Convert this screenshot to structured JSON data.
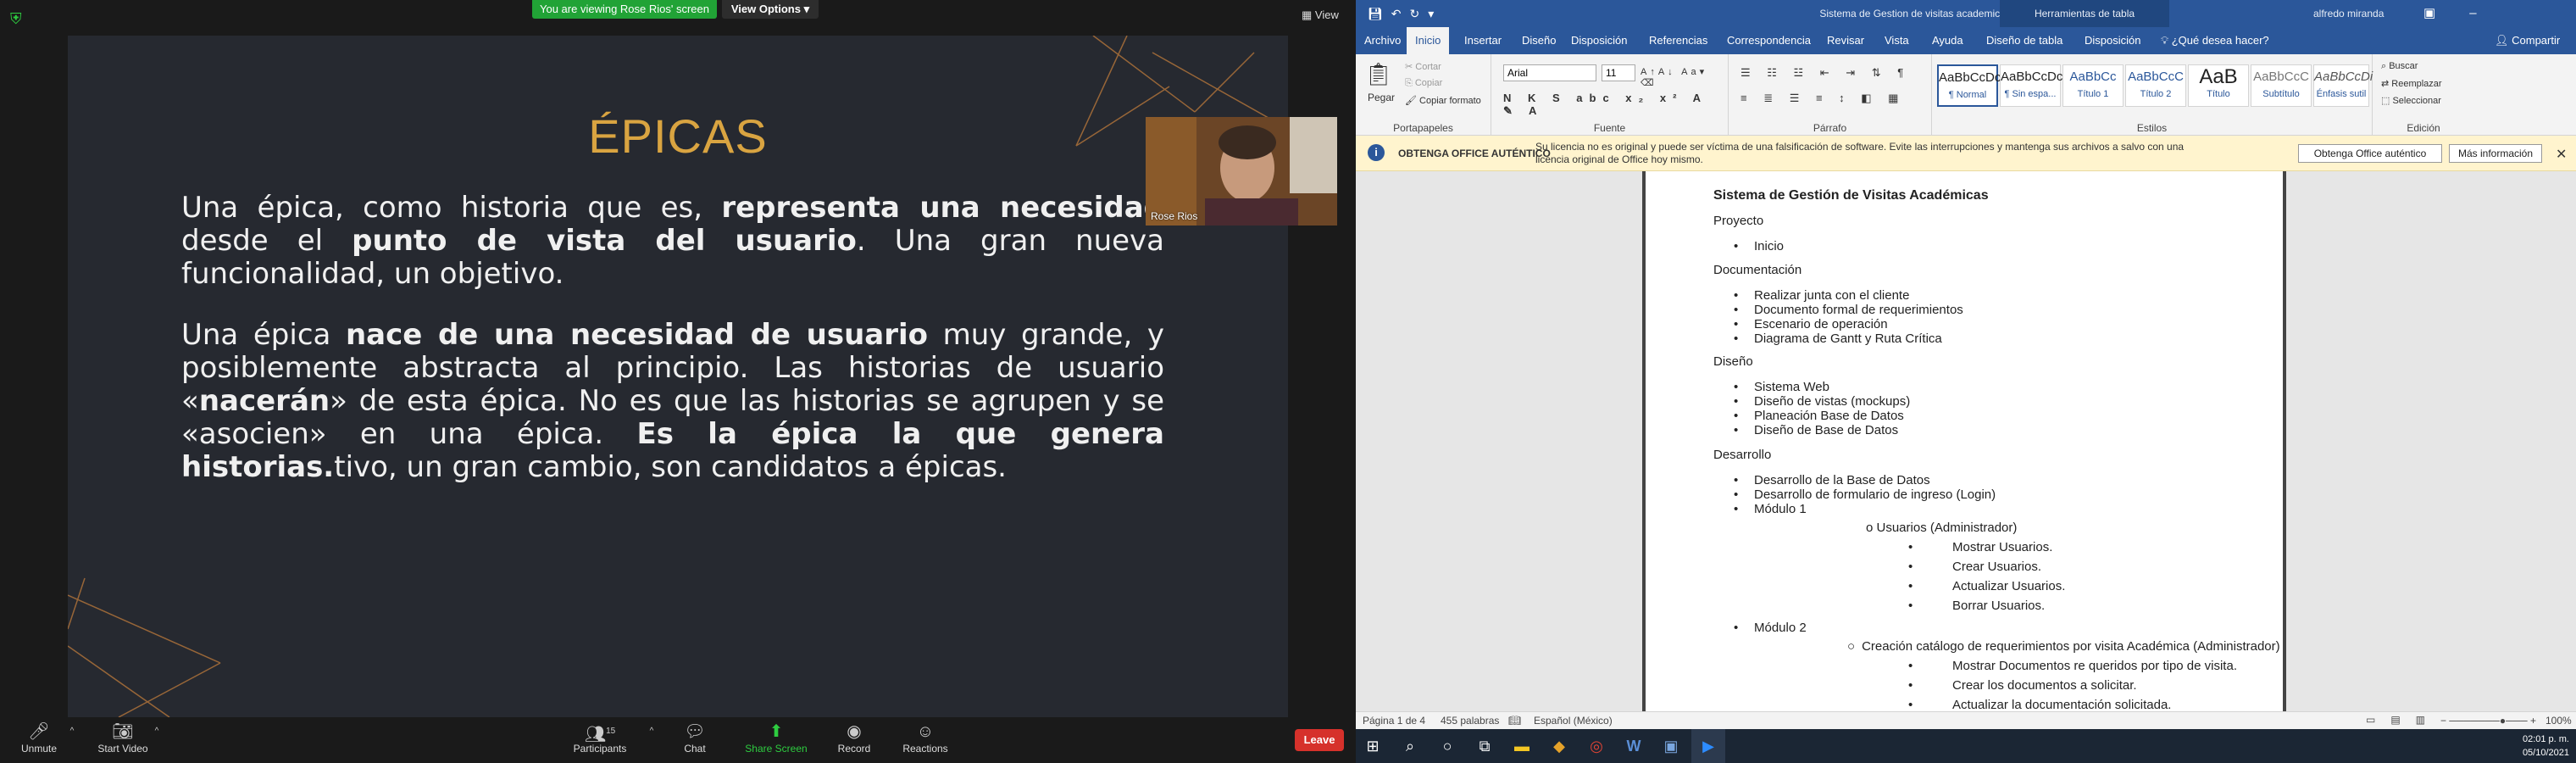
{
  "zoom": {
    "viewing_banner": "You are viewing Rose Rios' screen",
    "view_options": "View Options ▾",
    "view_btn": "View",
    "participant_name": "Rose Rios",
    "slide": {
      "title": "ÉPICAS",
      "para1": [
        {
          "t": "Una épica, como historia que es, ",
          "b": false
        },
        {
          "t": "representa una necesidad",
          "b": true
        },
        {
          "t": " desde el ",
          "b": false
        },
        {
          "t": "punto de vista del usuario",
          "b": true
        },
        {
          "t": ". Una gran nueva funcionalidad, un objetivo.",
          "b": false
        }
      ],
      "para2": [
        {
          "t": "Una épica ",
          "b": false
        },
        {
          "t": "nace de una necesidad de usuario",
          "b": true
        },
        {
          "t": " muy grande, y posiblemente abstracta al principio. Las historias de usuario «",
          "b": false
        },
        {
          "t": "nacerán",
          "b": true
        },
        {
          "t": "» de esta épica. No es que las historias se agrupen y se «asocien» en una épica. ",
          "b": false
        },
        {
          "t": "Es la épica la que genera historias.",
          "b": true
        },
        {
          "t": "tivo, un gran cambio, son candidatos a épicas.",
          "b": false
        }
      ]
    },
    "toolbar": {
      "unmute": "Unmute",
      "start_video": "Start Video",
      "participants": "Participants",
      "participants_count": "15",
      "chat": "Chat",
      "share_screen": "Share Screen",
      "record": "Record",
      "reactions": "Reactions",
      "leave": "Leave"
    }
  },
  "word": {
    "window_title": "Sistema de Gestion de visitas academicas (Glosario.docx - Word",
    "table_tools": "Herramientas de tabla",
    "user": "alfredo miranda",
    "tabs": [
      "Archivo",
      "Inicio",
      "Insertar",
      "Diseño",
      "Disposición",
      "Referencias",
      "Correspondencia",
      "Revisar",
      "Vista",
      "Ayuda",
      "Diseño de tabla",
      "Disposición",
      "¿Qué desea hacer?"
    ],
    "share": "Compartir",
    "ribbon": {
      "paste": "Pegar",
      "cut": "Cortar",
      "copy": "Copiar",
      "format_painter": "Copiar formato",
      "clipboard_label": "Portapapeles",
      "font": "Arial",
      "size": "11",
      "font_label": "Fuente",
      "paragraph_label": "Párrafo",
      "styles_label": "Estilos",
      "edit_label": "Edición",
      "find": "Buscar",
      "replace": "Reemplazar",
      "select": "Seleccionar",
      "styles": [
        {
          "sample": "AaBbCcDc",
          "name": "¶ Normal"
        },
        {
          "sample": "AaBbCcDc",
          "name": "¶ Sin espa..."
        },
        {
          "sample": "AaBbCc",
          "name": "Título 1"
        },
        {
          "sample": "AaBbCcC",
          "name": "Título 2"
        },
        {
          "sample": "AaB",
          "name": "Título"
        },
        {
          "sample": "AaBbCcC",
          "name": "Subtítulo"
        },
        {
          "sample": "AaBbCcDi",
          "name": "Énfasis sutil"
        }
      ]
    },
    "notice": {
      "title": "OBTENGA OFFICE AUTÉNTICO",
      "text": "Su licencia no es original y puede ser víctima de una falsificación de software. Evite las interrupciones y mantenga sus archivos a salvo con una licencia original de Office hoy mismo.",
      "btn1": "Obtenga Office auténtico",
      "btn2": "Más información"
    },
    "doc": {
      "heading": "Sistema de Gestión de Visitas Académicas",
      "proyecto": "Proyecto",
      "inicio": "Inicio",
      "documentacion": "Documentación",
      "doc_items": [
        "Realizar junta con el cliente",
        "Documento formal de requerimientos",
        "Escenario de operación",
        "Diagrama de Gantt y Ruta Crítica"
      ],
      "diseno": "Diseño",
      "diseno_items": [
        "Sistema Web",
        "Diseño de vistas (mockups)",
        "Planeación Base de Datos",
        "Diseño de Base de Datos"
      ],
      "desarrollo": "Desarrollo",
      "desarrollo_items": [
        "Desarrollo de la Base de Datos",
        "Desarrollo de formulario de ingreso (Login)",
        "Módulo 1"
      ],
      "usuarios": "o Usuarios (Administrador)",
      "usuarios_items": [
        "Mostrar Usuarios.",
        "Crear Usuarios.",
        "Actualizar Usuarios.",
        "Borrar Usuarios."
      ],
      "modulo2": "Módulo 2",
      "catalogo": "Creación catálogo de requerimientos por visita Académica (Administrador)",
      "catalogo_items": [
        "Mostrar Documentos re queridos por tipo de visita.",
        "Crear los documentos a solicitar.",
        "Actualizar la documentación solicitada."
      ]
    },
    "status": {
      "page": "Página 1 de 4",
      "words": "455 palabras",
      "lang": "Español (México)",
      "zoom": "100%"
    }
  },
  "taskbar": {
    "time": "02:01 p. m.",
    "date": "05/10/2021"
  }
}
